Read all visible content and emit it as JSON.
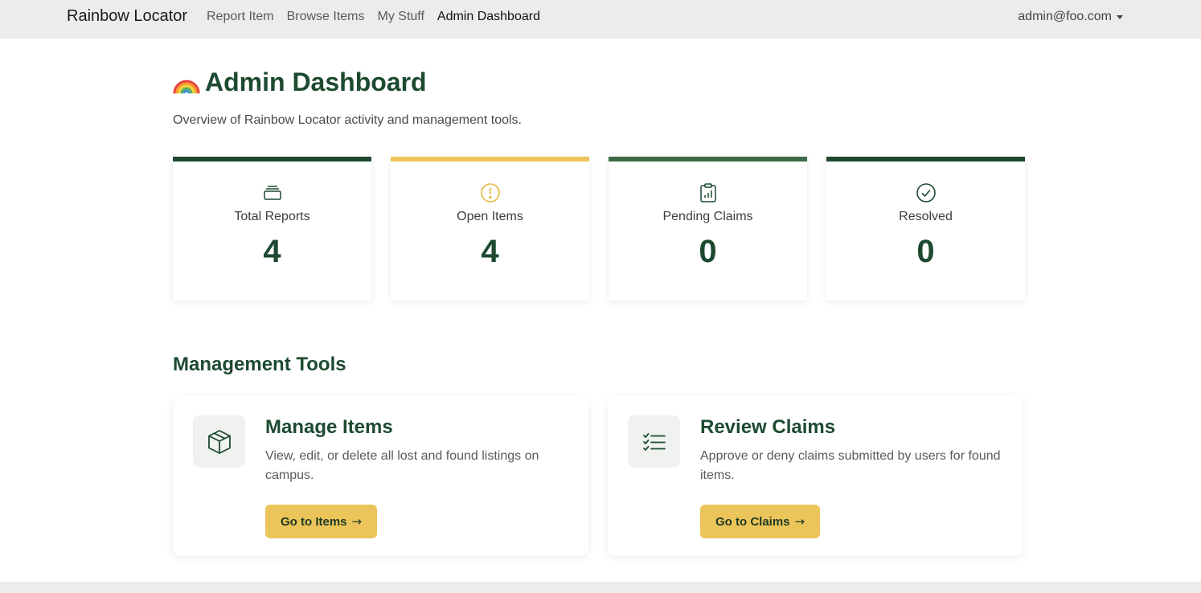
{
  "navbar": {
    "brand": "Rainbow Locator",
    "links": [
      {
        "label": "Report Item"
      },
      {
        "label": "Browse Items"
      },
      {
        "label": "My Stuff"
      },
      {
        "label": "Admin Dashboard",
        "active": true
      }
    ],
    "user_email": "admin@foo.com"
  },
  "header": {
    "title": "Admin Dashboard",
    "icon": "rainbow-icon",
    "subtitle": "Overview of Rainbow Locator activity and management tools."
  },
  "stats": [
    {
      "label": "Total Reports",
      "value": "4",
      "icon": "stack-icon",
      "accent": "#1d4a30"
    },
    {
      "label": "Open Items",
      "value": "4",
      "icon": "exclamation-circle-icon",
      "accent": "#ecc55a"
    },
    {
      "label": "Pending Claims",
      "value": "0",
      "icon": "clipboard-chart-icon",
      "accent": "#3d6b48"
    },
    {
      "label": "Resolved",
      "value": "0",
      "icon": "check-circle-icon",
      "accent": "#1d4a30"
    }
  ],
  "management": {
    "title": "Management Tools",
    "tools": [
      {
        "title": "Manage Items",
        "description": "View, edit, or delete all lost and found listings on campus.",
        "button": "Go to Items",
        "icon": "box-icon"
      },
      {
        "title": "Review Claims",
        "description": "Approve or deny claims submitted by users for found items.",
        "button": "Go to Claims",
        "icon": "checklist-icon"
      }
    ]
  },
  "theme": {
    "primary": "#1d4a30",
    "accent_yellow": "#ecc55a",
    "nav_bg": "#ececec"
  }
}
